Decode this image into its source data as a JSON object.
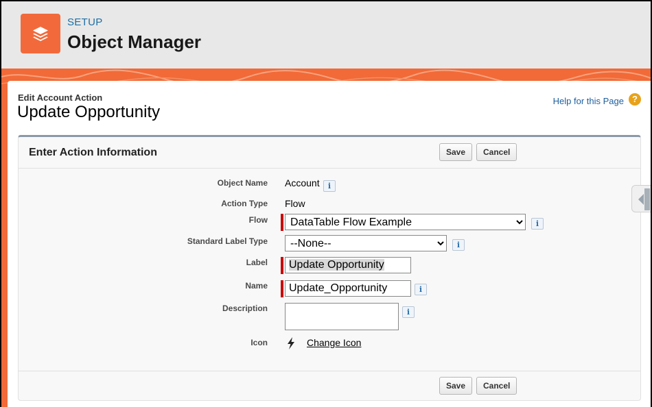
{
  "header": {
    "eyebrow": "SETUP",
    "title": "Object Manager"
  },
  "page": {
    "subtitle": "Edit Account Action",
    "title": "Update Opportunity",
    "help_link": "Help for this Page",
    "help_icon": "?"
  },
  "panel": {
    "title": "Enter Action Information",
    "save_label": "Save",
    "cancel_label": "Cancel"
  },
  "fields": {
    "object_name_label": "Object Name",
    "object_name_value": "Account",
    "action_type_label": "Action Type",
    "action_type_value": "Flow",
    "flow_label": "Flow",
    "flow_value": "DataTable Flow Example",
    "standard_label_type_label": "Standard Label Type",
    "standard_label_type_value": "--None--",
    "label_label": "Label",
    "label_value": "Update Opportunity",
    "name_label": "Name",
    "name_value": "Update_Opportunity",
    "description_label": "Description",
    "description_value": "",
    "icon_label": "Icon",
    "change_icon_link": "Change Icon",
    "info_glyph": "i"
  },
  "colors": {
    "brand_orange": "#f26a3b",
    "required_red": "#cc0000",
    "link_blue": "#1d5e9e"
  }
}
